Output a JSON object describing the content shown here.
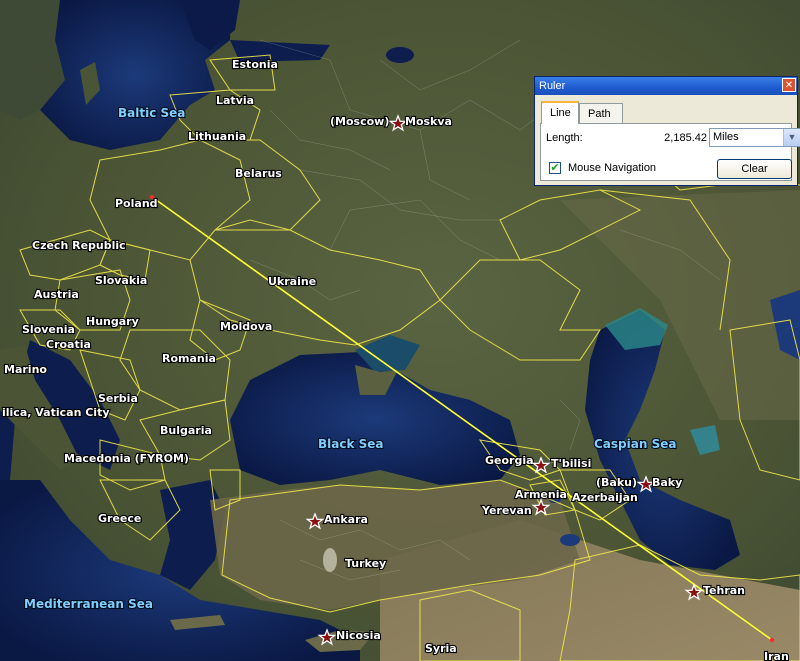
{
  "map": {
    "seas": [
      {
        "name": "Baltic Sea"
      },
      {
        "name": "Black Sea"
      },
      {
        "name": "Caspian Sea"
      },
      {
        "name": "Mediterranean Sea"
      }
    ],
    "countries": [
      {
        "name": "Estonia"
      },
      {
        "name": "Latvia"
      },
      {
        "name": "Lithuania"
      },
      {
        "name": "Belarus"
      },
      {
        "name": "Poland"
      },
      {
        "name": "Czech Republic"
      },
      {
        "name": "Slovakia"
      },
      {
        "name": "Austria"
      },
      {
        "name": "Hungary"
      },
      {
        "name": "Slovenia"
      },
      {
        "name": "Croatia"
      },
      {
        "name": "Moldova"
      },
      {
        "name": "Ukraine"
      },
      {
        "name": "Romania"
      },
      {
        "name": "Serbia"
      },
      {
        "name": "Bulgaria"
      },
      {
        "name": "Macedonia (FYROM)"
      },
      {
        "name": "Greece"
      },
      {
        "name": "Turkey"
      },
      {
        "name": "Georgia"
      },
      {
        "name": "Armenia"
      },
      {
        "name": "Azerbaijan"
      },
      {
        "name": "Syria"
      },
      {
        "name": "Iran"
      },
      {
        "name": "Marino"
      },
      {
        "name": "ilica, Vatican City"
      }
    ],
    "cities": [
      {
        "name": "Moskva",
        "alt": "(Moscow)"
      },
      {
        "name": "T'bilisi"
      },
      {
        "name": "Baky",
        "alt": "(Baku)"
      },
      {
        "name": "Yerevan"
      },
      {
        "name": "Ankara"
      },
      {
        "name": "Tehran"
      },
      {
        "name": "Nicosia"
      }
    ]
  },
  "ruler": {
    "title": "Ruler",
    "close_icon": "close-icon",
    "tabs": [
      {
        "label": "Line",
        "active": true
      },
      {
        "label": "Path",
        "active": false
      }
    ],
    "length_label": "Length:",
    "length_value": "2,185.42",
    "unit": "Miles",
    "mouse_navigation_label": "Mouse Navigation",
    "mouse_navigation_checked": true,
    "clear_label": "Clear"
  },
  "colors": {
    "measure_line": "#ffff33",
    "border": "#f2e84a",
    "sea": "#0c1d4e",
    "land": "#4b5a3a"
  }
}
